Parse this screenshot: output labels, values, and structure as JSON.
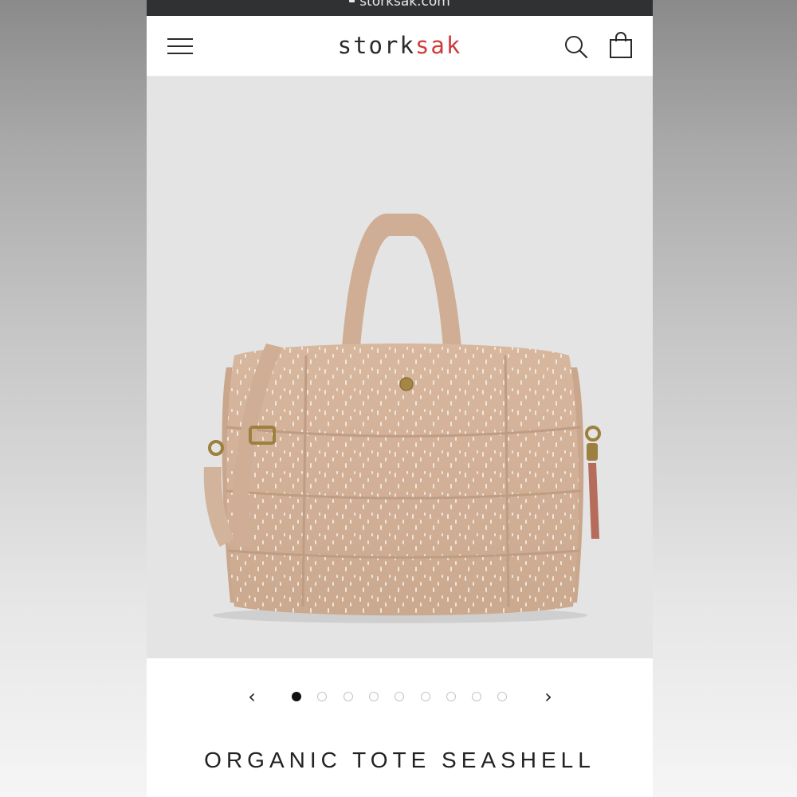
{
  "browser": {
    "url": "storksak.com"
  },
  "header": {
    "logo_main": "stork",
    "logo_accent": "sak",
    "menu_icon": "hamburger-menu-icon",
    "search_icon": "search-icon",
    "cart_icon": "shopping-bag-icon"
  },
  "colors": {
    "accent": "#d23a3a",
    "product": "#d5b39a",
    "hero_bg": "#e4e4e4"
  },
  "gallery": {
    "prev_label": "‹",
    "next_label": "›",
    "image_count": 9,
    "active_index": 0
  },
  "product": {
    "title": "ORGANIC TOTE SEASHELL"
  }
}
